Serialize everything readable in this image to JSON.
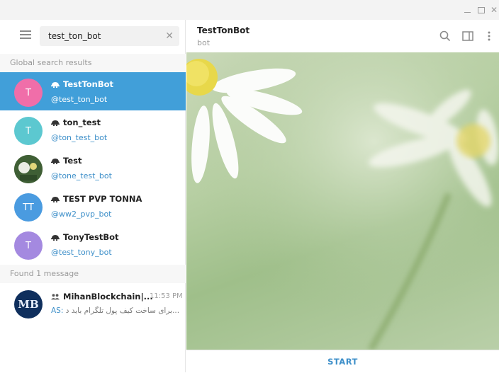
{
  "window": {
    "controls": [
      "minimize",
      "maximize",
      "close"
    ]
  },
  "search": {
    "value": "test_ton_bot"
  },
  "global_search": {
    "header": "Global search results",
    "results": [
      {
        "name": "TestTonBot",
        "handle": "@test_ton_bot",
        "avatar_letter": "T",
        "avatar_color": "#f06ea9",
        "active": true
      },
      {
        "name": "ton_test",
        "handle": "@ton_test_bot",
        "avatar_letter": "T",
        "avatar_color": "#5cc8d0",
        "active": false
      },
      {
        "name": "Test",
        "handle": "@tone_test_bot",
        "avatar_letter": "",
        "avatar_color": "#4a6a3a",
        "active": false
      },
      {
        "name": "TEST PVP TONNA",
        "handle": "@ww2_pvp_bot",
        "avatar_letter": "TT",
        "avatar_color": "#4a9be0",
        "active": false
      },
      {
        "name": "TonyTestBot",
        "handle": "@test_tony_bot",
        "avatar_letter": "T",
        "avatar_color": "#a489e0",
        "active": false
      }
    ]
  },
  "found_messages": {
    "header": "Found 1 message",
    "items": [
      {
        "name": "MihanBlockchain|...",
        "time": "11:53 PM",
        "from": "AS:",
        "preview": "برای ساخت کیف پول تلگرام باید د...",
        "avatar_text": "MB"
      }
    ]
  },
  "chat": {
    "title": "TestTonBot",
    "subtitle": "bot",
    "start_label": "START"
  }
}
